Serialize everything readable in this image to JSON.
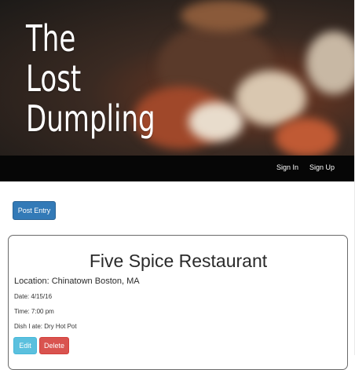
{
  "hero": {
    "title_lines": [
      "The",
      "Lost",
      "Dumpling"
    ]
  },
  "nav": {
    "sign_in": "Sign In",
    "sign_up": "Sign Up"
  },
  "actions": {
    "post_entry": "Post Entry"
  },
  "entry": {
    "restaurant": "Five Spice Restaurant",
    "location": "Location: Chinatown Boston, MA",
    "date": "Date: 4/15/16",
    "time": "Time: 7:00 pm",
    "dish": "Dish I ate: Dry Hot Pot",
    "edit_label": "Edit",
    "delete_label": "Delete"
  },
  "colors": {
    "primary": "#337ab7",
    "info": "#5bc0de",
    "danger": "#d9534f",
    "navbar": "#060606"
  }
}
